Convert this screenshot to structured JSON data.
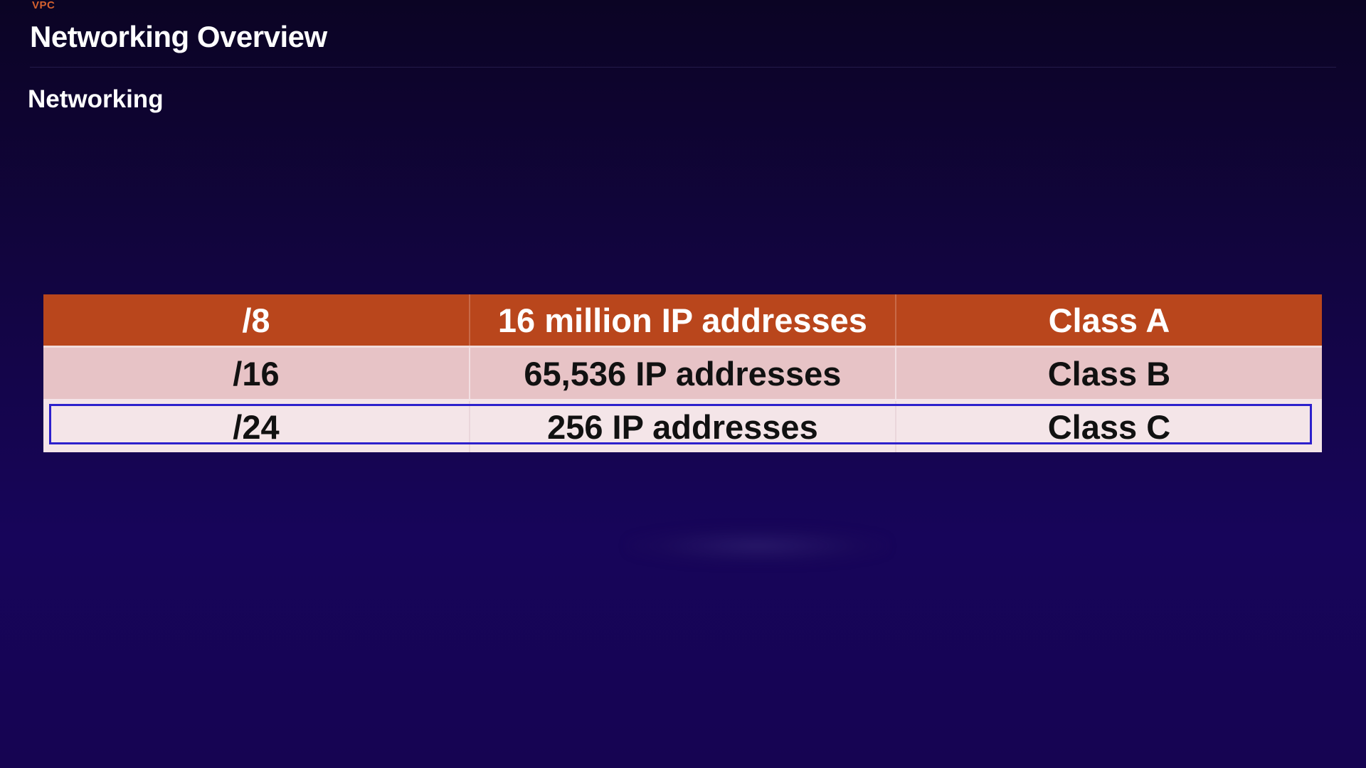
{
  "header": {
    "eyebrow": "VPC",
    "title": "Networking Overview"
  },
  "section": {
    "label": "Networking"
  },
  "table": {
    "rows": [
      {
        "prefix": "/8",
        "addresses": "16 million IP addresses",
        "class": "Class A"
      },
      {
        "prefix": "/16",
        "addresses": "65,536 IP addresses",
        "class": "Class B"
      },
      {
        "prefix": "/24",
        "addresses": "256 IP addresses",
        "class": "Class C"
      }
    ],
    "highlighted_row": 3
  },
  "colors": {
    "header_row": "#b9461c",
    "row_b": "#e7c3c6",
    "row_c": "#f4e5e8",
    "highlight_border": "#2d20cc",
    "eyebrow": "#d4612f",
    "background": "#120540"
  }
}
